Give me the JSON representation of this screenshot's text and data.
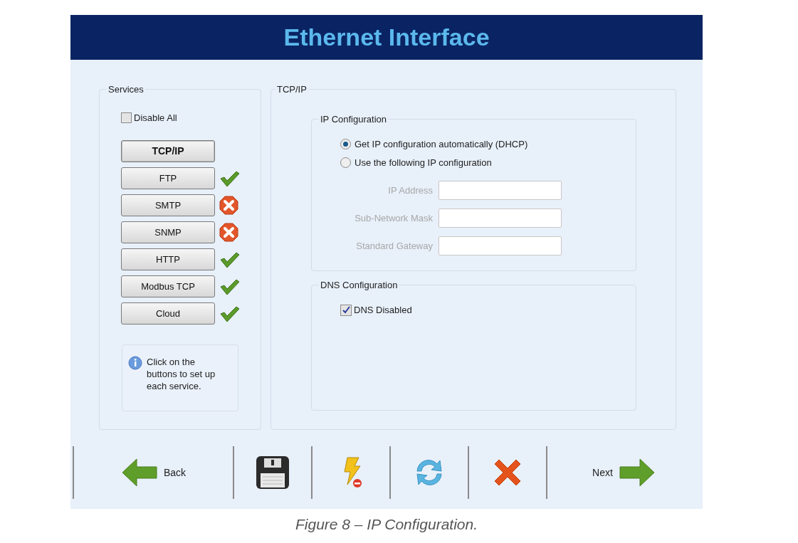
{
  "title": "Ethernet Interface",
  "services": {
    "title": "Services",
    "disable_all": {
      "label": "Disable All",
      "checked": false
    },
    "buttons": [
      {
        "label": "TCP/IP",
        "selected": true,
        "kind": "plain"
      },
      {
        "label": "FTP",
        "selected": false,
        "kind": "enabled"
      },
      {
        "label": "SMTP",
        "selected": false,
        "kind": "failed"
      },
      {
        "label": "SNMP",
        "selected": false,
        "kind": "failed"
      },
      {
        "label": "HTTP",
        "selected": false,
        "kind": "enabled"
      },
      {
        "label": "Modbus TCP",
        "selected": false,
        "kind": "enabled"
      },
      {
        "label": "Cloud",
        "selected": false,
        "kind": "enabled"
      }
    ],
    "hint": "Click on the buttons to set up each service."
  },
  "tcpip": {
    "title": "TCP/IP",
    "ip_configuration": {
      "title": "IP Configuration",
      "options": [
        {
          "label": "Get IP configuration automatically (DHCP)",
          "selected": true
        },
        {
          "label": "Use the following IP configuration",
          "selected": false
        }
      ],
      "fields_disabled": true,
      "fields": [
        {
          "label": "IP Address"
        },
        {
          "label": "Sub-Network Mask"
        },
        {
          "label": "Standard Gateway"
        }
      ]
    },
    "dns_configuration": {
      "title": "DNS Configuration",
      "dns_disabled": {
        "label": "DNS Disabled",
        "checked": true
      }
    }
  },
  "toolbar": [
    {
      "kind": "back",
      "label": "Back"
    },
    {
      "kind": "save"
    },
    {
      "kind": "flash"
    },
    {
      "kind": "refresh"
    },
    {
      "kind": "cancel"
    },
    {
      "kind": "next",
      "label": "Next"
    }
  ],
  "caption": "Figure 8 – IP Configuration."
}
